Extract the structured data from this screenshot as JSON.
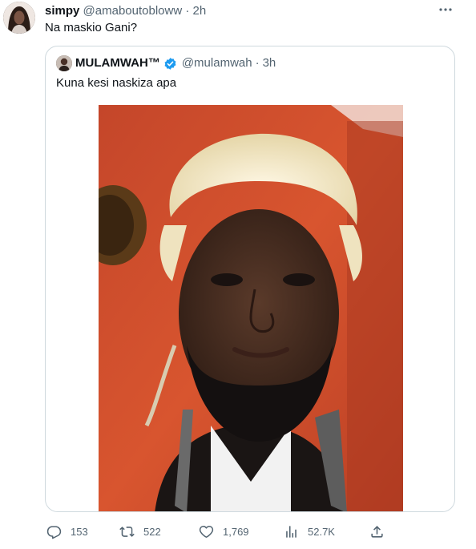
{
  "tweet": {
    "author_name": "simpy",
    "author_handle": "@amaboutobloww",
    "separator": "·",
    "time": "2h",
    "text": "Na maskio Gani?"
  },
  "quoted": {
    "author_name": "MULAMWAH™",
    "author_handle": "@mulamwah",
    "separator": "·",
    "time": "3h",
    "text": "Kuna kesi naskiza apa",
    "verified": true
  },
  "actions": {
    "replies": "153",
    "retweets": "522",
    "likes": "1,769",
    "views": "52.7K"
  },
  "icons": [
    "more-icon",
    "verified-icon",
    "reply-icon",
    "retweet-icon",
    "like-icon",
    "views-icon",
    "share-icon"
  ],
  "colors": {
    "text": "#0f1419",
    "secondary": "#536471",
    "border": "#cfd9de",
    "verified": "#1d9bf0"
  }
}
